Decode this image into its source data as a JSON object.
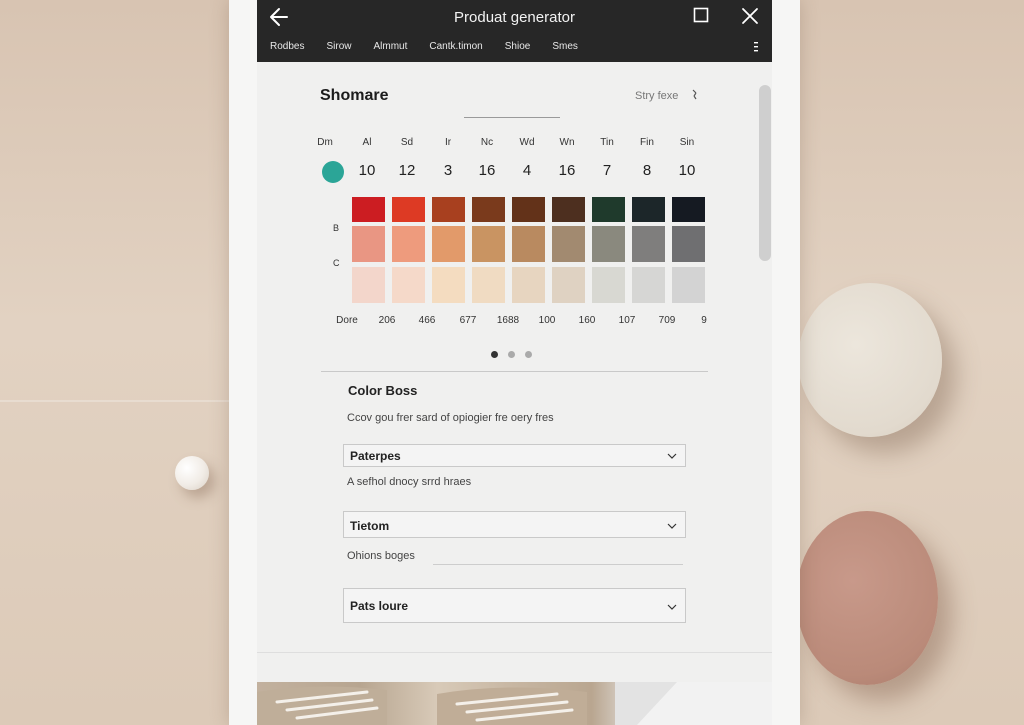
{
  "app": {
    "title": "Produat generator",
    "tabs": [
      "Rodbes",
      "Sirow",
      "Almmut",
      "Cantk.timon",
      "Shioe",
      "Smes"
    ]
  },
  "section": {
    "title": "Shomare",
    "sort_label": "Stry fexe"
  },
  "days": {
    "headers": [
      "Dm",
      "Al",
      "Sd",
      "Ir",
      "Nc",
      "Wd",
      "Wn",
      "Tin",
      "Fin",
      "Sin"
    ],
    "values": [
      "",
      "10",
      "12",
      "3",
      "16",
      "4",
      "16",
      "7",
      "8",
      "10"
    ]
  },
  "swatch_rows": {
    "labels": [
      "",
      "B",
      "C"
    ]
  },
  "swatch_colors": [
    [
      "#cc1d22",
      "#dd3a24",
      "#a8401f",
      "#7a3a1c",
      "#633219",
      "#4d2f1f",
      "#1f3a2c",
      "#1c2629",
      "#151a22"
    ],
    [
      "#e99683",
      "#ee9b7d",
      "#e29a6a",
      "#c99462",
      "#b98a60",
      "#a28a70",
      "#8a897e",
      "#7f7e7d",
      "#6f6f71"
    ],
    [
      "#f3d6cb",
      "#f5d9c9",
      "#f4dcc0",
      "#f0dbc2",
      "#e7d5c0",
      "#dfd2c2",
      "#d8d8d2",
      "#d6d6d4",
      "#d3d3d3"
    ]
  ],
  "footer_labels": [
    "Dore",
    "206",
    "466",
    "677",
    "1688",
    "100",
    "160",
    "107",
    "709",
    "9"
  ],
  "pager": {
    "count": 3,
    "active": 0
  },
  "color_box": {
    "title": "Color Boss",
    "description": "Ccov gou frer sard of opiogier fre oery fres"
  },
  "dropdowns": [
    {
      "label": "Paterpes",
      "sub": "A sefhol dnocy srrd hraes"
    },
    {
      "label": "Tietom",
      "sub": "Ohions boges"
    },
    {
      "label": "Pats loure",
      "sub": ""
    }
  ],
  "colors": {
    "appbar": "#272727",
    "accent_teal": "#2ba597"
  },
  "icons": [
    "back-arrow-icon",
    "maximize-icon",
    "close-icon",
    "more-icon",
    "sort-icon",
    "chevron-down-icon"
  ]
}
